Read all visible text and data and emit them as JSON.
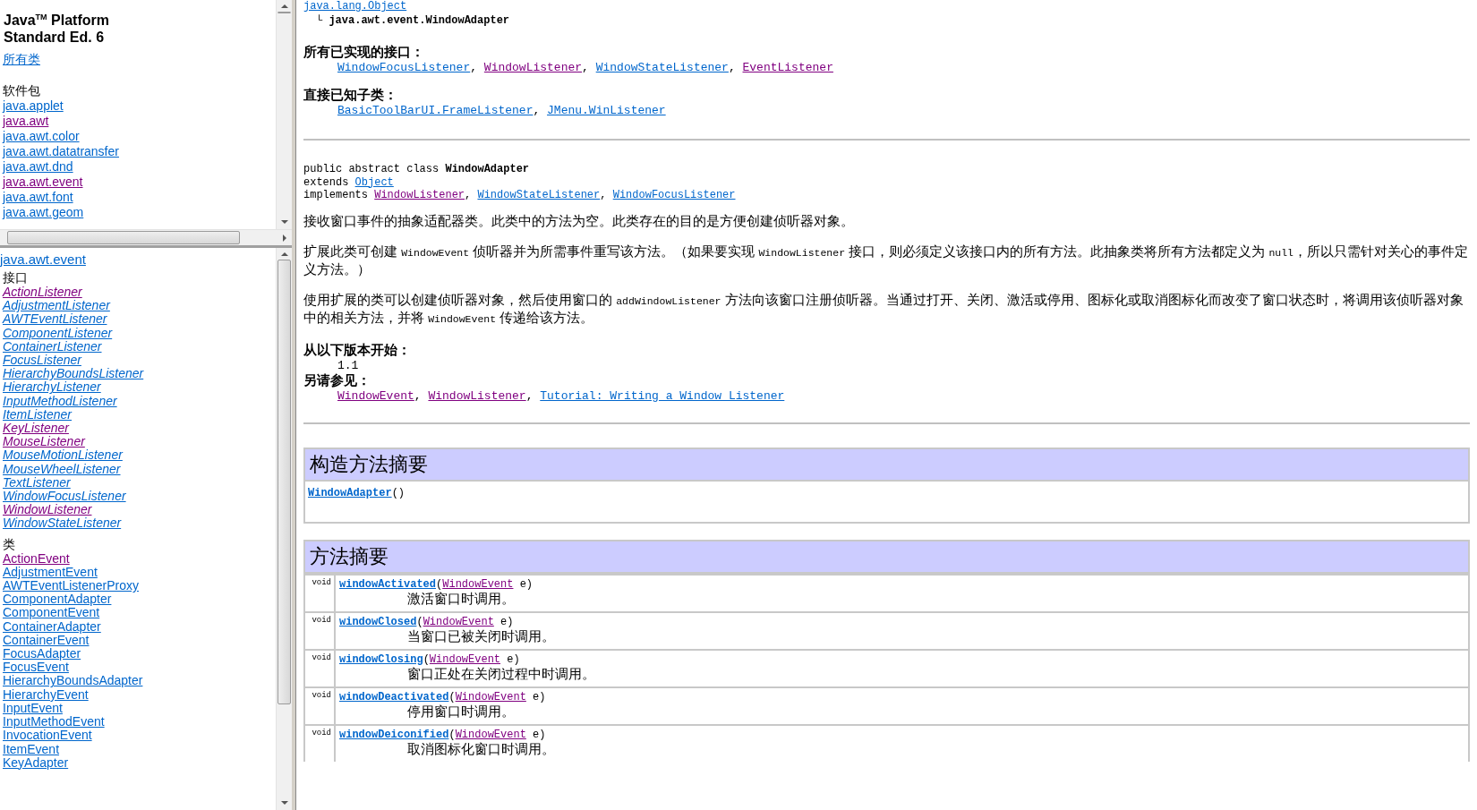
{
  "packages_frame": {
    "title_lines": [
      "Java$^{TM}$ Platform",
      "Standard Ed. 6"
    ],
    "all_classes_link": {
      "text": "所有类",
      "visited": false
    },
    "heading": "软件包",
    "packages": [
      {
        "name": "java.applet",
        "visited": false
      },
      {
        "name": "java.awt",
        "visited": true
      },
      {
        "name": "java.awt.color",
        "visited": false
      },
      {
        "name": "java.awt.datatransfer",
        "visited": false
      },
      {
        "name": "java.awt.dnd",
        "visited": false
      },
      {
        "name": "java.awt.event",
        "visited": true
      },
      {
        "name": "java.awt.font",
        "visited": false
      },
      {
        "name": "java.awt.geom",
        "visited": false
      }
    ]
  },
  "classes_frame": {
    "package_link": {
      "text": "java.awt.event",
      "visited": false
    },
    "interfaces_heading": "接口",
    "interfaces": [
      {
        "name": "ActionListener",
        "visited": true
      },
      {
        "name": "AdjustmentListener",
        "visited": false
      },
      {
        "name": "AWTEventListener",
        "visited": false
      },
      {
        "name": "ComponentListener",
        "visited": false
      },
      {
        "name": "ContainerListener",
        "visited": false
      },
      {
        "name": "FocusListener",
        "visited": false
      },
      {
        "name": "HierarchyBoundsListener",
        "visited": false
      },
      {
        "name": "HierarchyListener",
        "visited": false
      },
      {
        "name": "InputMethodListener",
        "visited": false
      },
      {
        "name": "ItemListener",
        "visited": false
      },
      {
        "name": "KeyListener",
        "visited": true
      },
      {
        "name": "MouseListener",
        "visited": true
      },
      {
        "name": "MouseMotionListener",
        "visited": false
      },
      {
        "name": "MouseWheelListener",
        "visited": false
      },
      {
        "name": "TextListener",
        "visited": false
      },
      {
        "name": "WindowFocusListener",
        "visited": false
      },
      {
        "name": "WindowListener",
        "visited": true
      },
      {
        "name": "WindowStateListener",
        "visited": false
      }
    ],
    "classes_heading": "类",
    "classes": [
      {
        "name": "ActionEvent",
        "visited": true
      },
      {
        "name": "AdjustmentEvent",
        "visited": false
      },
      {
        "name": "AWTEventListenerProxy",
        "visited": false
      },
      {
        "name": "ComponentAdapter",
        "visited": false
      },
      {
        "name": "ComponentEvent",
        "visited": false
      },
      {
        "name": "ContainerAdapter",
        "visited": false
      },
      {
        "name": "ContainerEvent",
        "visited": false
      },
      {
        "name": "FocusAdapter",
        "visited": false
      },
      {
        "name": "FocusEvent",
        "visited": false
      },
      {
        "name": "HierarchyBoundsAdapter",
        "visited": false
      },
      {
        "name": "HierarchyEvent",
        "visited": false
      },
      {
        "name": "InputEvent",
        "visited": false
      },
      {
        "name": "InputMethodEvent",
        "visited": false
      },
      {
        "name": "InvocationEvent",
        "visited": false
      },
      {
        "name": "ItemEvent",
        "visited": false
      },
      {
        "name": "KeyAdapter",
        "visited": false
      }
    ]
  },
  "content": {
    "hierarchy": {
      "root": {
        "text": "java.lang.Object",
        "visited": false
      },
      "branch": "└",
      "leaf": "java.awt.event.WindowAdapter"
    },
    "implemented_interfaces": {
      "heading": "所有已实现的接口：",
      "segments": [
        {
          "kind": "link",
          "text": "WindowFocusListener",
          "visited": false
        },
        {
          "kind": "text",
          "text": ", "
        },
        {
          "kind": "link",
          "text": "WindowListener",
          "visited": true
        },
        {
          "kind": "text",
          "text": ", "
        },
        {
          "kind": "link",
          "text": "WindowStateListener",
          "visited": false
        },
        {
          "kind": "text",
          "text": ", "
        },
        {
          "kind": "link",
          "text": "EventListener",
          "visited": true
        }
      ]
    },
    "known_subclasses": {
      "heading": "直接已知子类：",
      "segments": [
        {
          "kind": "link",
          "text": "BasicToolBarUI.FrameListener",
          "visited": false
        },
        {
          "kind": "text",
          "text": ", "
        },
        {
          "kind": "link",
          "text": "JMenu.WinListener",
          "visited": false
        }
      ]
    },
    "declaration": [
      [
        {
          "kind": "text",
          "text": "public abstract class "
        },
        {
          "kind": "bold",
          "text": "WindowAdapter"
        }
      ],
      [
        {
          "kind": "text",
          "text": "extends "
        },
        {
          "kind": "link",
          "text": "Object",
          "visited": false
        }
      ],
      [
        {
          "kind": "text",
          "text": "implements "
        },
        {
          "kind": "link",
          "text": "WindowListener",
          "visited": true
        },
        {
          "kind": "text",
          "text": ", "
        },
        {
          "kind": "link",
          "text": "WindowStateListener",
          "visited": false
        },
        {
          "kind": "text",
          "text": ", "
        },
        {
          "kind": "link",
          "text": "WindowFocusListener",
          "visited": false
        }
      ]
    ],
    "paragraphs": [
      [
        {
          "kind": "text",
          "text": "接收窗口事件的抽象适配器类。此类中的方法为空。此类存在的目的是方便创建侦听器对象。"
        }
      ],
      [
        {
          "kind": "text",
          "text": "扩展此类可创建 "
        },
        {
          "kind": "code",
          "text": "WindowEvent"
        },
        {
          "kind": "text",
          "text": " 侦听器并为所需事件重写该方法。（如果要实现 "
        },
        {
          "kind": "code",
          "text": "WindowListener"
        },
        {
          "kind": "text",
          "text": " 接口，则必须定义该接口内的所有方法。此抽象类将所有方法都定义为 "
        },
        {
          "kind": "code",
          "text": "null"
        },
        {
          "kind": "text",
          "text": "，所以只需针对关心的事件定义方法。）"
        }
      ],
      [
        {
          "kind": "text",
          "text": "使用扩展的类可以创建侦听器对象，然后使用窗口的 "
        },
        {
          "kind": "code",
          "text": "addWindowListener"
        },
        {
          "kind": "text",
          "text": " 方法向该窗口注册侦听器。当通过打开、关闭、激活或停用、图标化或取消图标化而改变了窗口状态时，将调用该侦听器对象中的相关方法，并将 "
        },
        {
          "kind": "code",
          "text": "WindowEvent"
        },
        {
          "kind": "text",
          "text": " 传递给该方法。"
        }
      ]
    ],
    "since": {
      "heading": "从以下版本开始：",
      "value": "1.1"
    },
    "see_also": {
      "heading": "另请参见：",
      "segments": [
        {
          "kind": "link",
          "text": "WindowEvent",
          "visited": true
        },
        {
          "kind": "text",
          "text": ", "
        },
        {
          "kind": "link",
          "text": "WindowListener",
          "visited": true
        },
        {
          "kind": "text",
          "text": ", "
        },
        {
          "kind": "link",
          "text": "Tutorial: Writing a Window Listener",
          "visited": false
        }
      ]
    },
    "constructor_summary": {
      "title": "构造方法摘要",
      "rows": [
        {
          "signature": [
            {
              "kind": "method",
              "text": "WindowAdapter",
              "visited": false
            },
            {
              "kind": "text",
              "text": "()"
            }
          ]
        }
      ]
    },
    "method_summary": {
      "title": "方法摘要",
      "rows": [
        {
          "type": "void",
          "signature": [
            {
              "kind": "method",
              "text": "windowActivated",
              "visited": false
            },
            {
              "kind": "text",
              "text": "("
            },
            {
              "kind": "link",
              "text": "WindowEvent",
              "visited": true
            },
            {
              "kind": "text",
              "text": " e)"
            }
          ],
          "description": "激活窗口时调用。"
        },
        {
          "type": "void",
          "signature": [
            {
              "kind": "method",
              "text": "windowClosed",
              "visited": false
            },
            {
              "kind": "text",
              "text": "("
            },
            {
              "kind": "link",
              "text": "WindowEvent",
              "visited": true
            },
            {
              "kind": "text",
              "text": " e)"
            }
          ],
          "description": "当窗口已被关闭时调用。"
        },
        {
          "type": "void",
          "signature": [
            {
              "kind": "method",
              "text": "windowClosing",
              "visited": false
            },
            {
              "kind": "text",
              "text": "("
            },
            {
              "kind": "link",
              "text": "WindowEvent",
              "visited": true
            },
            {
              "kind": "text",
              "text": " e)"
            }
          ],
          "description": "窗口正处在关闭过程中时调用。"
        },
        {
          "type": "void",
          "signature": [
            {
              "kind": "method",
              "text": "windowDeactivated",
              "visited": false
            },
            {
              "kind": "text",
              "text": "("
            },
            {
              "kind": "link",
              "text": "WindowEvent",
              "visited": true
            },
            {
              "kind": "text",
              "text": " e)"
            }
          ],
          "description": "停用窗口时调用。"
        },
        {
          "type": "void",
          "signature": [
            {
              "kind": "method",
              "text": "windowDeiconified",
              "visited": false
            },
            {
              "kind": "text",
              "text": "("
            },
            {
              "kind": "link",
              "text": "WindowEvent",
              "visited": true
            },
            {
              "kind": "text",
              "text": " e)"
            }
          ],
          "description": "取消图标化窗口时调用。"
        }
      ]
    }
  }
}
